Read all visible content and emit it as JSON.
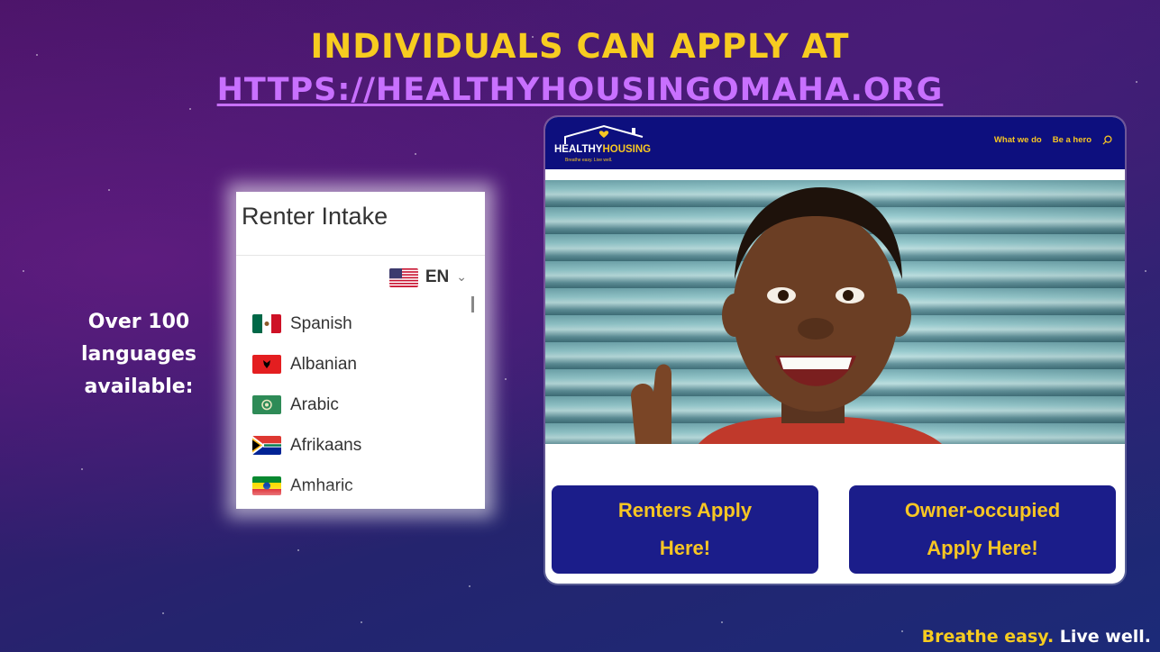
{
  "slide": {
    "title_line1": "INDIVIDUALS CAN APPLY AT",
    "title_line2": "HTTPS://HEALTHYHOUSINGOMAHA.ORG",
    "languages_caption_lines": [
      "Over 100",
      "languages",
      "available:"
    ],
    "tagline_part1": "Breathe easy.",
    "tagline_part2": "Live well.",
    "colors": {
      "title": "#f7cc20",
      "link": "#c870ff",
      "tagline_accent": "#f7cc20"
    }
  },
  "intake": {
    "title": "Renter Intake",
    "selected_language_code": "EN",
    "selected_flag": "us-flag-icon",
    "languages": [
      {
        "name": "Spanish",
        "flag": "mexico-flag-icon"
      },
      {
        "name": "Albanian",
        "flag": "albania-flag-icon"
      },
      {
        "name": "Arabic",
        "flag": "arab-league-flag-icon"
      },
      {
        "name": "Afrikaans",
        "flag": "south-africa-flag-icon"
      },
      {
        "name": "Amharic",
        "flag": "ethiopia-flag-icon"
      }
    ]
  },
  "site": {
    "logo_word_plain": "HEALTHY",
    "logo_word_highlight": "HOUSING",
    "logo_tagline": "Breathe easy. Live well.",
    "menu": [
      "What we do",
      "Be a hero"
    ],
    "buttons": {
      "renters_line1": "Renters Apply",
      "renters_line2": "Here!",
      "owner_line1": "Owner-occupied",
      "owner_line2": "Apply Here!"
    },
    "colors": {
      "nav_bg": "#0d0f7e",
      "button_bg": "#1b1d8a",
      "button_text": "#f7c623"
    }
  }
}
